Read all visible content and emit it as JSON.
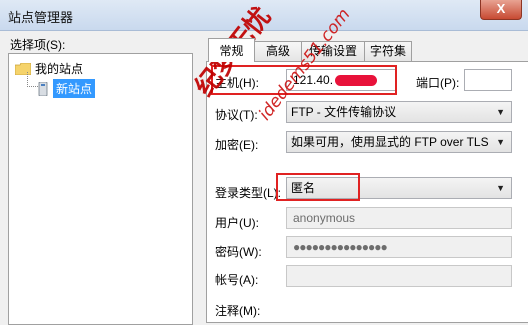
{
  "window": {
    "title": "站点管理器",
    "close_label": "X"
  },
  "left": {
    "label": "选择项(S):",
    "tree": {
      "root_label": "我的站点",
      "child_label": "新站点"
    }
  },
  "tabs": [
    "常规",
    "高级",
    "传输设置",
    "字符集"
  ],
  "form": {
    "host": {
      "label": "主机(H):",
      "value": "121.40."
    },
    "port": {
      "label": "端口(P):",
      "value": ""
    },
    "protocol": {
      "label": "协议(T):",
      "value": "FTP - 文件传输协议"
    },
    "encryption": {
      "label": "加密(E):",
      "value": "如果可用，使用显式的 FTP over TLS"
    },
    "login_type": {
      "label": "登录类型(L):",
      "value": "匿名"
    },
    "user": {
      "label": "用户(U):",
      "value": "anonymous"
    },
    "password": {
      "label": "密码(W):",
      "value": "●●●●●●●●●●●●●●●"
    },
    "account": {
      "label": "帐号(A):",
      "value": ""
    },
    "comment": {
      "label": "注释(M):"
    }
  },
  "watermark": {
    "text": "纪梦无忧",
    "site": "idedems51.com"
  },
  "colors": {
    "highlight": "#e02222",
    "selection": "#3399ff",
    "watermark": "#c00000"
  }
}
